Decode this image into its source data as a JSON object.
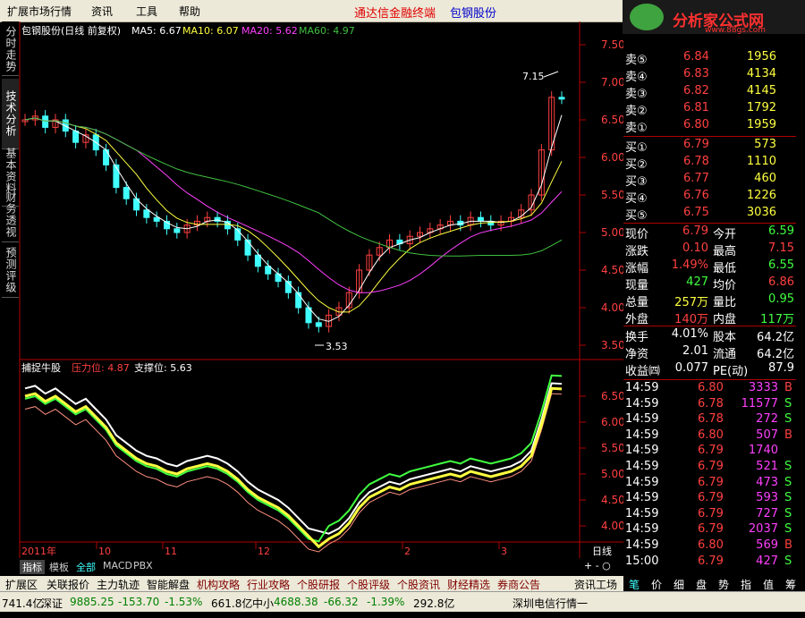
{
  "menu": {
    "items": [
      "扩展市场行情",
      "资讯",
      "工具",
      "帮助"
    ],
    "title": "通达信金融终端",
    "stock": "包钢股份"
  },
  "logo": {
    "text": "分析家公式网",
    "url": "www.88gs.com"
  },
  "side_tabs": [
    "分时走势",
    "技术分析",
    "基本资料",
    "财务透视",
    "预测评级"
  ],
  "chart_header": {
    "name": "包钢股份(日线 前复权)",
    "ma5": "MA5: 6.67",
    "ma10": "MA10: 6.07",
    "ma20": "MA20: 5.62",
    "ma60": "MA60: 4.97",
    "high_label": "7.15",
    "low_label": "3.53"
  },
  "indicator_header": {
    "name": "捕捉牛股",
    "pressure": "压力位: 4.87",
    "support": "支撑位: 5.63"
  },
  "price_axis": [
    "7.50",
    "7.00",
    "6.50",
    "6.00",
    "5.50",
    "5.00",
    "4.50",
    "4.00",
    "3.50"
  ],
  "ind_axis": [
    "6.50",
    "6.00",
    "5.50",
    "5.00",
    "4.50",
    "4.00"
  ],
  "date_axis": [
    "2011年",
    "10",
    "11",
    "12",
    "2",
    "3"
  ],
  "period_label": "日线",
  "order_book": {
    "asks": [
      {
        "label": "卖⑤",
        "price": "6.84",
        "vol": "1956"
      },
      {
        "label": "卖④",
        "price": "6.83",
        "vol": "4134"
      },
      {
        "label": "卖③",
        "price": "6.82",
        "vol": "4145"
      },
      {
        "label": "卖②",
        "price": "6.81",
        "vol": "1792"
      },
      {
        "label": "卖①",
        "price": "6.80",
        "vol": "1959"
      }
    ],
    "bids": [
      {
        "label": "买①",
        "price": "6.79",
        "vol": "573"
      },
      {
        "label": "买②",
        "price": "6.78",
        "vol": "1110"
      },
      {
        "label": "买③",
        "price": "6.77",
        "vol": "460"
      },
      {
        "label": "买④",
        "price": "6.76",
        "vol": "1226"
      },
      {
        "label": "买⑤",
        "price": "6.75",
        "vol": "3036"
      }
    ]
  },
  "quote": {
    "rows": [
      {
        "l1": "现价",
        "v1": "6.79",
        "c1": "red",
        "l2": "今开",
        "v2": "6.59",
        "c2": "grn"
      },
      {
        "l1": "涨跌",
        "v1": "0.10",
        "c1": "red",
        "l2": "最高",
        "v2": "7.15",
        "c2": "red"
      },
      {
        "l1": "涨幅",
        "v1": "1.49%",
        "c1": "red",
        "l2": "最低",
        "v2": "6.55",
        "c2": "grn"
      },
      {
        "l1": "现量",
        "v1": "427",
        "c1": "grn",
        "l2": "均价",
        "v2": "6.86",
        "c2": "red"
      },
      {
        "l1": "总量",
        "v1": "257万",
        "c1": "yel",
        "l2": "量比",
        "v2": "0.95",
        "c2": "grn"
      },
      {
        "l1": "外盘",
        "v1": "140万",
        "c1": "red",
        "l2": "内盘",
        "v2": "117万",
        "c2": "grn"
      }
    ],
    "rows2": [
      {
        "l1": "换手",
        "v1": "4.01%",
        "l2": "股本",
        "v2": "64.2亿"
      },
      {
        "l1": "净资",
        "v1": "2.01",
        "l2": "流通",
        "v2": "64.2亿"
      },
      {
        "l1": "收益㈣",
        "v1": "0.077",
        "l2": "PE(动)",
        "v2": "87.9"
      }
    ]
  },
  "ticks": [
    {
      "t": "14:59",
      "p": "6.80",
      "v": "3333",
      "s": "B"
    },
    {
      "t": "14:59",
      "p": "6.78",
      "v": "11577",
      "s": "S"
    },
    {
      "t": "14:59",
      "p": "6.78",
      "v": "272",
      "s": "S"
    },
    {
      "t": "14:59",
      "p": "6.80",
      "v": "507",
      "s": "B"
    },
    {
      "t": "14:59",
      "p": "6.79",
      "v": "1740",
      "s": ""
    },
    {
      "t": "14:59",
      "p": "6.79",
      "v": "521",
      "s": "S"
    },
    {
      "t": "14:59",
      "p": "6.79",
      "v": "473",
      "s": "S"
    },
    {
      "t": "14:59",
      "p": "6.79",
      "v": "593",
      "s": "S"
    },
    {
      "t": "14:59",
      "p": "6.79",
      "v": "727",
      "s": "S"
    },
    {
      "t": "14:59",
      "p": "6.79",
      "v": "2037",
      "s": "S"
    },
    {
      "t": "14:59",
      "p": "6.80",
      "v": "569",
      "s": "B"
    },
    {
      "t": "15:00",
      "p": "6.79",
      "v": "427",
      "s": "S"
    }
  ],
  "bottom_tabs": [
    "指标",
    "模板",
    "全部",
    "MACD",
    "PBX"
  ],
  "func_bar": [
    "扩展区",
    "关联报价",
    "主力轨迹",
    "智能解盘",
    "机构攻略",
    "行业攻略",
    "个股研报",
    "个股评级",
    "个股资讯",
    "财经精选",
    "券商公告",
    "资讯工场"
  ],
  "right_tabs": [
    "笔",
    "价",
    "细",
    "盘",
    "势",
    "指",
    "值",
    "筹"
  ],
  "status": {
    "s1": "741.4亿",
    "s2_name": "深证",
    "s2_val": "9885.25",
    "s2_chg": "-153.70",
    "s2_pct": "-1.53%",
    "s2_amt": "661.8亿",
    "s3_name": "中小",
    "s3_val": "4688.38",
    "s3_chg": "-66.32",
    "s3_pct": "-1.39%",
    "s3_amt": "292.8亿",
    "s4": "深圳电信行情一"
  },
  "colors": {
    "up": "#ff4040",
    "down": "#40ff40",
    "ma5": "#ffffff",
    "ma10": "#ffff40",
    "ma20": "#ff40ff",
    "ma60": "#40c040"
  }
}
